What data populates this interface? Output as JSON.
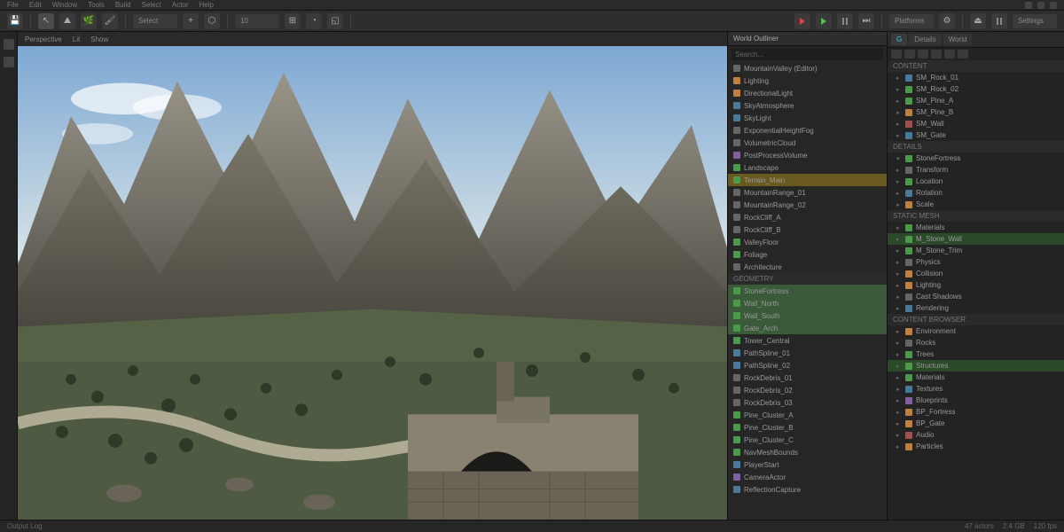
{
  "menubar": {
    "items": [
      "File",
      "Edit",
      "Window",
      "Tools",
      "Build",
      "Select",
      "Actor",
      "Help"
    ]
  },
  "toolbar": {
    "mode": "Select",
    "snap": "10",
    "play": "Play",
    "platforms": "Platforms",
    "settings": "Settings"
  },
  "viewport": {
    "tab": "Perspective",
    "lit": "Lit",
    "show": "Show"
  },
  "outliner": {
    "title": "World Outliner",
    "search": "Search...",
    "items": [
      {
        "label": "MountainValley (Editor)",
        "icon": "gray"
      },
      {
        "label": "Lighting",
        "icon": "orange"
      },
      {
        "label": "DirectionalLight",
        "icon": "orange"
      },
      {
        "label": "SkyAtmosphere",
        "icon": "blue"
      },
      {
        "label": "SkyLight",
        "icon": "blue"
      },
      {
        "label": "ExponentialHeightFog",
        "icon": "gray"
      },
      {
        "label": "VolumetricCloud",
        "icon": "gray"
      },
      {
        "label": "PostProcessVolume",
        "icon": "purple"
      },
      {
        "label": "Landscape",
        "icon": "green"
      },
      {
        "label": "Terrain_Main",
        "icon": "green",
        "hl": "yellow"
      },
      {
        "label": "MountainRange_01",
        "icon": "gray"
      },
      {
        "label": "MountainRange_02",
        "icon": "gray"
      },
      {
        "label": "RockCliff_A",
        "icon": "gray"
      },
      {
        "label": "RockCliff_B",
        "icon": "gray"
      },
      {
        "label": "ValleyFloor",
        "icon": "green"
      },
      {
        "label": "Foliage",
        "icon": "green"
      },
      {
        "label": "Architecture",
        "icon": "gray"
      }
    ],
    "sectionA": "Geometry",
    "geom": [
      {
        "label": "StoneFortress",
        "icon": "green",
        "sel": true
      },
      {
        "label": "Wall_North",
        "icon": "green",
        "sel": true
      },
      {
        "label": "Wall_South",
        "icon": "green",
        "sel": true
      },
      {
        "label": "Gate_Arch",
        "icon": "green",
        "sel": true
      },
      {
        "label": "Tower_Central",
        "icon": "green"
      },
      {
        "label": "PathSpline_01",
        "icon": "blue"
      },
      {
        "label": "PathSpline_02",
        "icon": "blue"
      },
      {
        "label": "RockDebris_01",
        "icon": "gray"
      },
      {
        "label": "RockDebris_02",
        "icon": "gray"
      },
      {
        "label": "RockDebris_03",
        "icon": "gray"
      },
      {
        "label": "Pine_Cluster_A",
        "icon": "green"
      },
      {
        "label": "Pine_Cluster_B",
        "icon": "green"
      },
      {
        "label": "Pine_Cluster_C",
        "icon": "green"
      },
      {
        "label": "NavMeshBounds",
        "icon": "green"
      },
      {
        "label": "PlayerStart",
        "icon": "blue"
      },
      {
        "label": "CameraActor",
        "icon": "purple"
      },
      {
        "label": "ReflectionCapture",
        "icon": "blue"
      }
    ]
  },
  "right": {
    "tabs": [
      "G",
      "Details",
      "World"
    ],
    "toolicons": 6,
    "sectionA": "Content",
    "assetsA": [
      {
        "label": "SM_Rock_01",
        "icon": "blue"
      },
      {
        "label": "SM_Rock_02",
        "icon": "green"
      },
      {
        "label": "SM_Pine_A",
        "icon": "green"
      },
      {
        "label": "SM_Pine_B",
        "icon": "orange"
      },
      {
        "label": "SM_Wall",
        "icon": "red"
      },
      {
        "label": "SM_Gate",
        "icon": "blue"
      }
    ],
    "sectionB": "Details",
    "detail_header": "StoneFortress",
    "props": [
      {
        "label": "Transform",
        "icon": "gray"
      },
      {
        "label": "Location",
        "icon": "green"
      },
      {
        "label": "Rotation",
        "icon": "blue"
      },
      {
        "label": "Scale",
        "icon": "orange"
      }
    ],
    "sectionC": "Static Mesh",
    "assetsB": [
      {
        "label": "Materials",
        "icon": "green"
      },
      {
        "label": "M_Stone_Wall",
        "icon": "green",
        "sel": true
      },
      {
        "label": "M_Stone_Trim",
        "icon": "green"
      },
      {
        "label": "Physics",
        "icon": "gray"
      },
      {
        "label": "Collision",
        "icon": "orange"
      },
      {
        "label": "Lighting",
        "icon": "orange"
      },
      {
        "label": "Cast Shadows",
        "icon": "gray"
      },
      {
        "label": "Rendering",
        "icon": "blue"
      }
    ],
    "sectionD": "Content Browser",
    "assetsC": [
      {
        "label": "Environment",
        "icon": "orange"
      },
      {
        "label": "Rocks",
        "icon": "gray"
      },
      {
        "label": "Trees",
        "icon": "green"
      },
      {
        "label": "Structures",
        "icon": "green",
        "sel": true
      },
      {
        "label": "Materials",
        "icon": "green"
      },
      {
        "label": "Textures",
        "icon": "blue"
      },
      {
        "label": "Blueprints",
        "icon": "purple"
      },
      {
        "label": "BP_Fortress",
        "icon": "orange"
      },
      {
        "label": "BP_Gate",
        "icon": "orange"
      },
      {
        "label": "Audio",
        "icon": "red"
      },
      {
        "label": "Particles",
        "icon": "orange"
      }
    ]
  },
  "status": {
    "left": "Output Log",
    "actors": "47 actors",
    "mem": "2.4 GB",
    "fps": "120 fps"
  }
}
